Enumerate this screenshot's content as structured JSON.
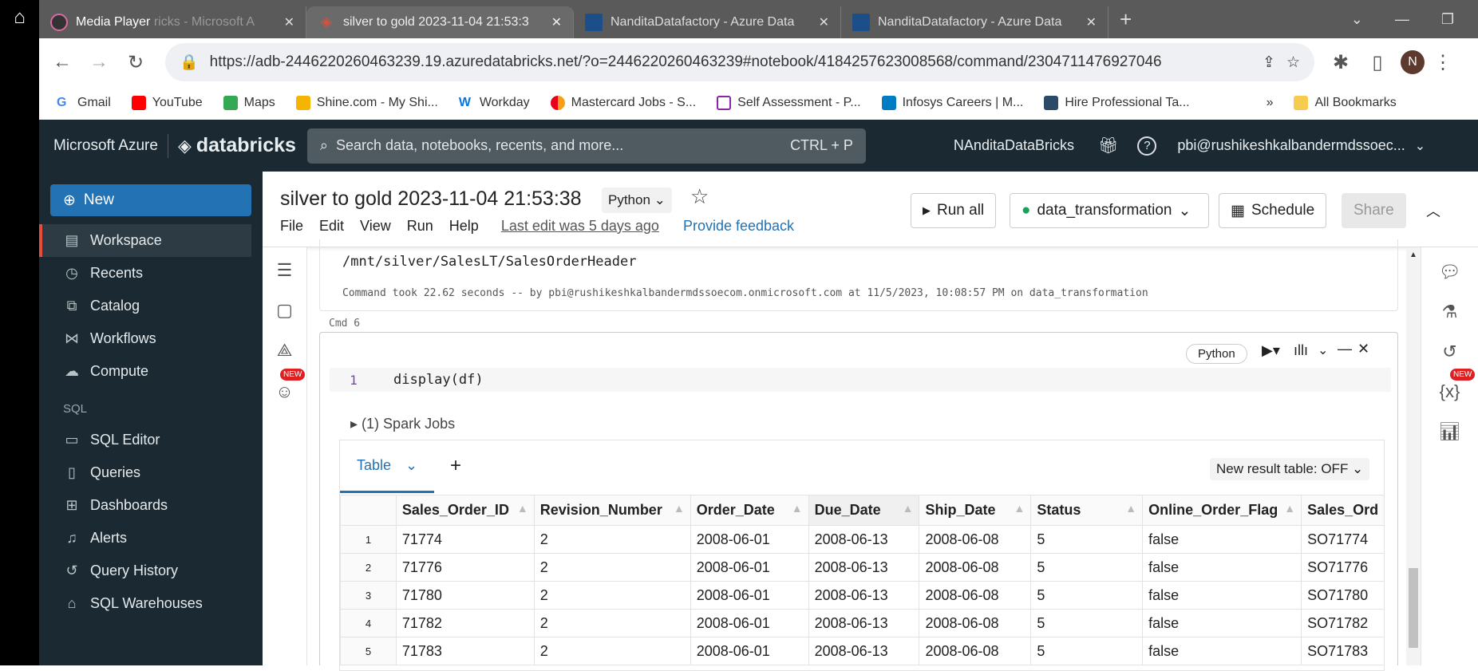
{
  "browser": {
    "tabs": [
      {
        "label": "Media Player",
        "sub": "ricks - Microsoft A"
      },
      {
        "label": "silver to gold 2023-11-04 21:53:3"
      },
      {
        "label": "NanditaDatafactory - Azure Data"
      },
      {
        "label": "NanditaDatafactory - Azure Data"
      }
    ],
    "url": "https://adb-2446220260463239.19.azuredatabricks.net/?o=2446220260463239#notebook/4184257623008568/command/2304711476927046",
    "profile": "N",
    "bookmarks": [
      "Gmail",
      "YouTube",
      "Maps",
      "Shine.com - My Shi...",
      "Workday",
      "Mastercard Jobs - S...",
      "Self Assessment - P...",
      "Infosys Careers | M...",
      "Hire Professional Ta..."
    ],
    "all_bookmarks": "All Bookmarks"
  },
  "header": {
    "brand": "Microsoft Azure",
    "product": "databricks",
    "search_placeholder": "Search data, notebooks, recents, and more...",
    "shortcut": "CTRL + P",
    "workspace": "NAnditaDataBricks",
    "user": "pbi@rushikeshkalbandermdssoec..."
  },
  "sidebar": {
    "new": "New",
    "items": [
      "Workspace",
      "Recents",
      "Catalog",
      "Workflows",
      "Compute"
    ],
    "sql_heading": "SQL",
    "sql_items": [
      "SQL Editor",
      "Queries",
      "Dashboards",
      "Alerts",
      "Query History",
      "SQL Warehouses"
    ]
  },
  "notebook": {
    "title": "silver to gold 2023-11-04 21:53:38",
    "language": "Python",
    "menu": [
      "File",
      "Edit",
      "View",
      "Run",
      "Help"
    ],
    "last_edit": "Last edit was 5 days ago",
    "feedback": "Provide feedback",
    "run_all": "Run all",
    "cluster": "data_transformation",
    "schedule": "Schedule",
    "share": "Share",
    "new_badge": "NEW"
  },
  "prev_cell": {
    "output": "/mnt/silver/SalesLT/SalesOrderHeader",
    "status": "Command took 22.62 seconds -- by pbi@rushikeshkalbandermdssoecom.onmicrosoft.com at 11/5/2023, 10:08:57 PM on data_transformation"
  },
  "cell": {
    "label": "Cmd 6",
    "language": "Python",
    "line_no": "1",
    "code": "display(df)",
    "spark_jobs": "(1) Spark Jobs",
    "tab": "Table",
    "new_result": "New result table: OFF"
  },
  "table": {
    "columns": [
      "Sales_Order_ID",
      "Revision_Number",
      "Order_Date",
      "Due_Date",
      "Ship_Date",
      "Status",
      "Online_Order_Flag",
      "Sales_Ord"
    ],
    "rows": [
      [
        "1",
        "71774",
        "2",
        "2008-06-01",
        "2008-06-13",
        "2008-06-08",
        "5",
        "false",
        "SO71774"
      ],
      [
        "2",
        "71776",
        "2",
        "2008-06-01",
        "2008-06-13",
        "2008-06-08",
        "5",
        "false",
        "SO71776"
      ],
      [
        "3",
        "71780",
        "2",
        "2008-06-01",
        "2008-06-13",
        "2008-06-08",
        "5",
        "false",
        "SO71780"
      ],
      [
        "4",
        "71782",
        "2",
        "2008-06-01",
        "2008-06-13",
        "2008-06-08",
        "5",
        "false",
        "SO71782"
      ],
      [
        "5",
        "71783",
        "2",
        "2008-06-01",
        "2008-06-13",
        "2008-06-08",
        "5",
        "false",
        "SO71783"
      ]
    ]
  }
}
